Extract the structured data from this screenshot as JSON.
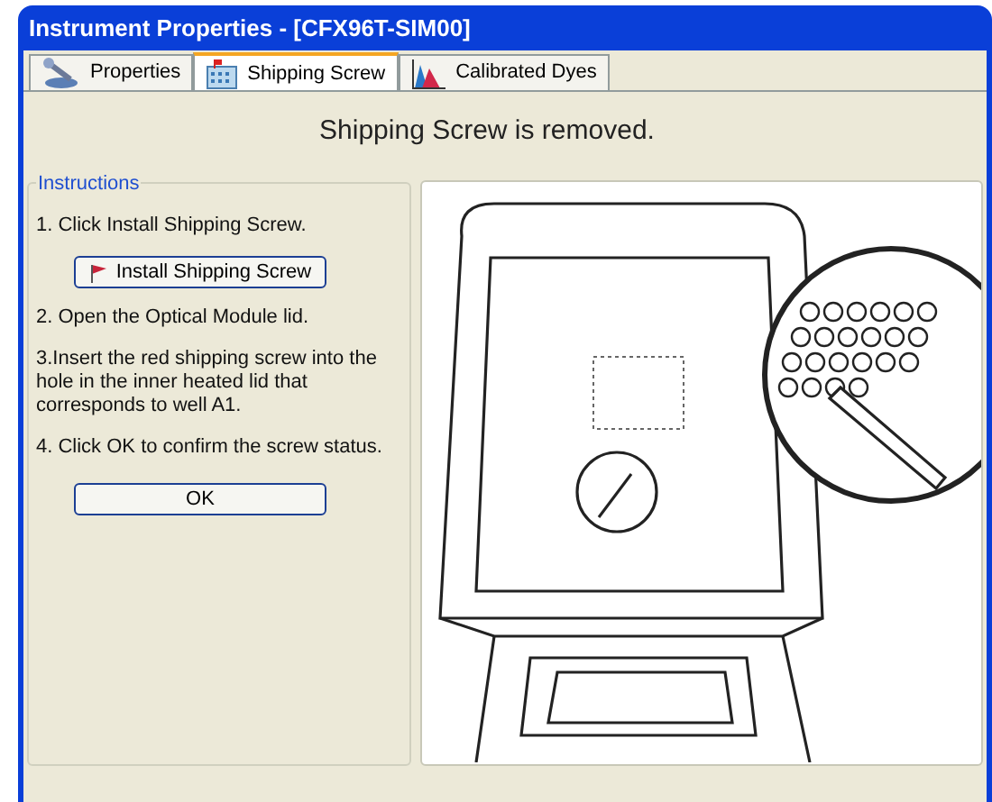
{
  "window": {
    "title": "Instrument Properties - [CFX96T-SIM00]"
  },
  "tabs": [
    {
      "label": "Properties",
      "selected": false,
      "kind": "wrench"
    },
    {
      "label": "Shipping Screw",
      "selected": true,
      "kind": "plate"
    },
    {
      "label": "Calibrated Dyes",
      "selected": false,
      "kind": "chart"
    }
  ],
  "status": "Shipping Screw is removed.",
  "instructions": {
    "title": "Instructions",
    "steps": [
      {
        "kind": "text",
        "text": "1. Click Install Shipping Screw."
      },
      {
        "kind": "button",
        "text": "Install Shipping Screw"
      },
      {
        "kind": "text",
        "text": "2. Open the Optical Module lid."
      },
      {
        "kind": "text",
        "text": "3.Insert the red shipping screw into the hole in the inner heated lid that corresponds to well A1."
      },
      {
        "kind": "text",
        "text": "4. Click OK to confirm the screw status."
      },
      {
        "kind": "ok",
        "text": "OK"
      }
    ]
  }
}
